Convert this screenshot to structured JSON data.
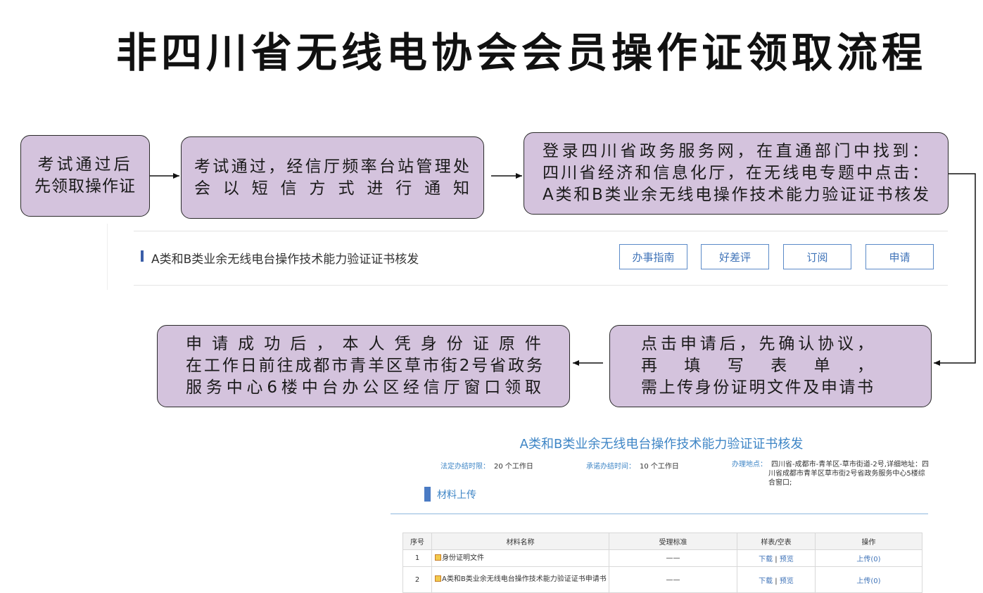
{
  "title": "非四川省无线电协会会员操作证领取流程",
  "flow": {
    "step1": [
      "考试通过后",
      "先领取操作证"
    ],
    "step2": [
      "考试通过，经信厅频率台站管理处",
      "会以短信方式进行通知"
    ],
    "step3": [
      "登录四川省政务服务网，在直通部门中找到：",
      "四川省经济和信息化厅，在无线电专题中点击：",
      "A类和B类业余无线电操作技术能力验证证书核发"
    ],
    "step4": [
      "点击申请后，先确认协议，",
      "再填写表单，",
      "需上传身份证明文件及申请书"
    ],
    "step5": [
      "申请成功后，本人凭身份证原件",
      "在工作日前往成都市青羊区草市街2号省政务",
      "服务中心6楼中台办公区经信厅窗口领取"
    ]
  },
  "service": {
    "title": "A类和B类业余无线电台操作技术能力验证证书核发",
    "buttons": [
      "办事指南",
      "好差评",
      "订阅",
      "申请"
    ]
  },
  "detail": {
    "title": "A类和B类业余无线电台操作技术能力验证证书核发",
    "legal_time_label": "法定办结时限：",
    "legal_time_value": "20 个工作日",
    "promise_time_label": "承诺办结时间：",
    "promise_time_value": "10 个工作日",
    "address_label": "办理地点：",
    "address_value": "四川省-成都市-青羊区-草市街道-2号,详细地址：四川省成都市青羊区草市街2号省政务服务中心5楼综合窗口;",
    "upload_title": "材料上传",
    "table": {
      "headers": [
        "序号",
        "材料名称",
        "受理标准",
        "样表/空表",
        "操作"
      ],
      "rows": [
        {
          "no": "1",
          "name": "身份证明文件",
          "standard": "——",
          "download": "下载",
          "preview": "预览",
          "op": "上传(0)"
        },
        {
          "no": "2",
          "name": "A类和B类业余无线电台操作技术能力验证证书申请书",
          "standard": "——",
          "download": "下载",
          "preview": "预览",
          "op": "上传(0)"
        }
      ]
    }
  },
  "colors": {
    "box_fill": "#d4c3dd",
    "link_blue": "#3f73b8",
    "title_blue": "#3f86c6"
  }
}
